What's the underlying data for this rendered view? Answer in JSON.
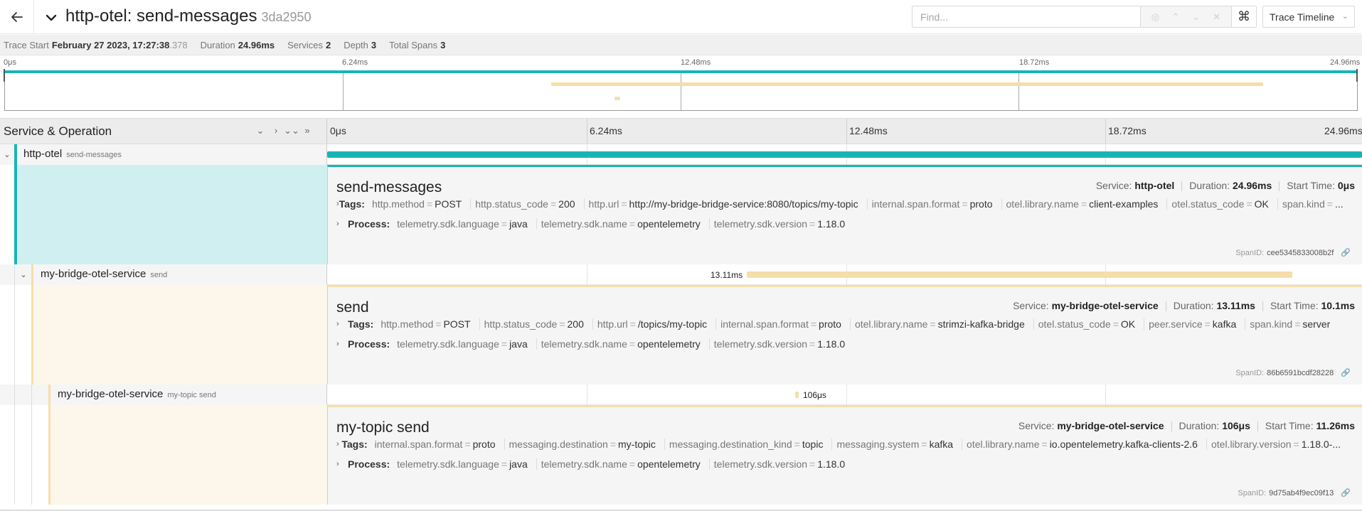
{
  "header": {
    "title": "http-otel: send-messages",
    "trace_id": "3da2950",
    "find_placeholder": "Find...",
    "keyboard_glyph": "⌘",
    "view_label": "Trace Timeline"
  },
  "summary": {
    "start_label": "Trace Start",
    "start_value": "February 27 2023, 17:27:38",
    "start_ms": ".378",
    "duration_label": "Duration",
    "duration_value": "24.96ms",
    "services_label": "Services",
    "services_value": "2",
    "depth_label": "Depth",
    "depth_value": "3",
    "spans_label": "Total Spans",
    "spans_value": "3"
  },
  "minimap": {
    "ticks": [
      "0μs",
      "6.24ms",
      "12.48ms",
      "18.72ms",
      "24.96ms"
    ]
  },
  "timeline": {
    "column_title": "Service & Operation",
    "ticks": [
      "0μs",
      "6.24ms",
      "12.48ms",
      "18.72ms",
      "24.96ms"
    ]
  },
  "colors": {
    "http_otel": "#18b4b4",
    "bridge": "#f5dfa9",
    "http_otel_fill": "#cfeff0",
    "bridge_fill": "#fdf6ea"
  },
  "spans": [
    {
      "service": "http-otel",
      "operation": "send-messages",
      "title": "send-messages",
      "service_label": "Service:",
      "service_value": "http-otel",
      "duration_label": "Duration:",
      "duration_value": "24.96ms",
      "start_label": "Start Time:",
      "start_value": "0μs",
      "tags_label": "Tags:",
      "tags": [
        {
          "k": "http.method",
          "v": "POST"
        },
        {
          "k": "http.status_code",
          "v": "200"
        },
        {
          "k": "http.url",
          "v": "http://my-bridge-bridge-service:8080/topics/my-topic"
        },
        {
          "k": "internal.span.format",
          "v": "proto"
        },
        {
          "k": "otel.library.name",
          "v": "client-examples"
        },
        {
          "k": "otel.status_code",
          "v": "OK"
        },
        {
          "k": "span.kind",
          "v": "..."
        }
      ],
      "process_label": "Process:",
      "process": [
        {
          "k": "telemetry.sdk.language",
          "v": "java"
        },
        {
          "k": "telemetry.sdk.name",
          "v": "opentelemetry"
        },
        {
          "k": "telemetry.sdk.version",
          "v": "1.18.0"
        }
      ],
      "span_id_label": "SpanID:",
      "span_id": "cee5345833008b2f",
      "bar_label": ""
    },
    {
      "service": "my-bridge-otel-service",
      "operation": "send",
      "title": "send",
      "service_label": "Service:",
      "service_value": "my-bridge-otel-service",
      "duration_label": "Duration:",
      "duration_value": "13.11ms",
      "start_label": "Start Time:",
      "start_value": "10.1ms",
      "tags_label": "Tags:",
      "tags": [
        {
          "k": "http.method",
          "v": "POST"
        },
        {
          "k": "http.status_code",
          "v": "200"
        },
        {
          "k": "http.url",
          "v": "/topics/my-topic"
        },
        {
          "k": "internal.span.format",
          "v": "proto"
        },
        {
          "k": "otel.library.name",
          "v": "strimzi-kafka-bridge"
        },
        {
          "k": "otel.status_code",
          "v": "OK"
        },
        {
          "k": "peer.service",
          "v": "kafka"
        },
        {
          "k": "span.kind",
          "v": "server"
        }
      ],
      "process_label": "Process:",
      "process": [
        {
          "k": "telemetry.sdk.language",
          "v": "java"
        },
        {
          "k": "telemetry.sdk.name",
          "v": "opentelemetry"
        },
        {
          "k": "telemetry.sdk.version",
          "v": "1.18.0"
        }
      ],
      "span_id_label": "SpanID:",
      "span_id": "86b6591bcdf28228",
      "bar_label": "13.11ms"
    },
    {
      "service": "my-bridge-otel-service",
      "operation": "my-topic send",
      "title": "my-topic send",
      "service_label": "Service:",
      "service_value": "my-bridge-otel-service",
      "duration_label": "Duration:",
      "duration_value": "106μs",
      "start_label": "Start Time:",
      "start_value": "11.26ms",
      "tags_label": "Tags:",
      "tags": [
        {
          "k": "internal.span.format",
          "v": "proto"
        },
        {
          "k": "messaging.destination",
          "v": "my-topic"
        },
        {
          "k": "messaging.destination_kind",
          "v": "topic"
        },
        {
          "k": "messaging.system",
          "v": "kafka"
        },
        {
          "k": "otel.library.name",
          "v": "io.opentelemetry.kafka-clients-2.6"
        },
        {
          "k": "otel.library.version",
          "v": "1.18.0-..."
        }
      ],
      "process_label": "Process:",
      "process": [
        {
          "k": "telemetry.sdk.language",
          "v": "java"
        },
        {
          "k": "telemetry.sdk.name",
          "v": "opentelemetry"
        },
        {
          "k": "telemetry.sdk.version",
          "v": "1.18.0"
        }
      ],
      "span_id_label": "SpanID:",
      "span_id": "9d75ab4f9ec09f13",
      "bar_label": "106μs"
    }
  ]
}
